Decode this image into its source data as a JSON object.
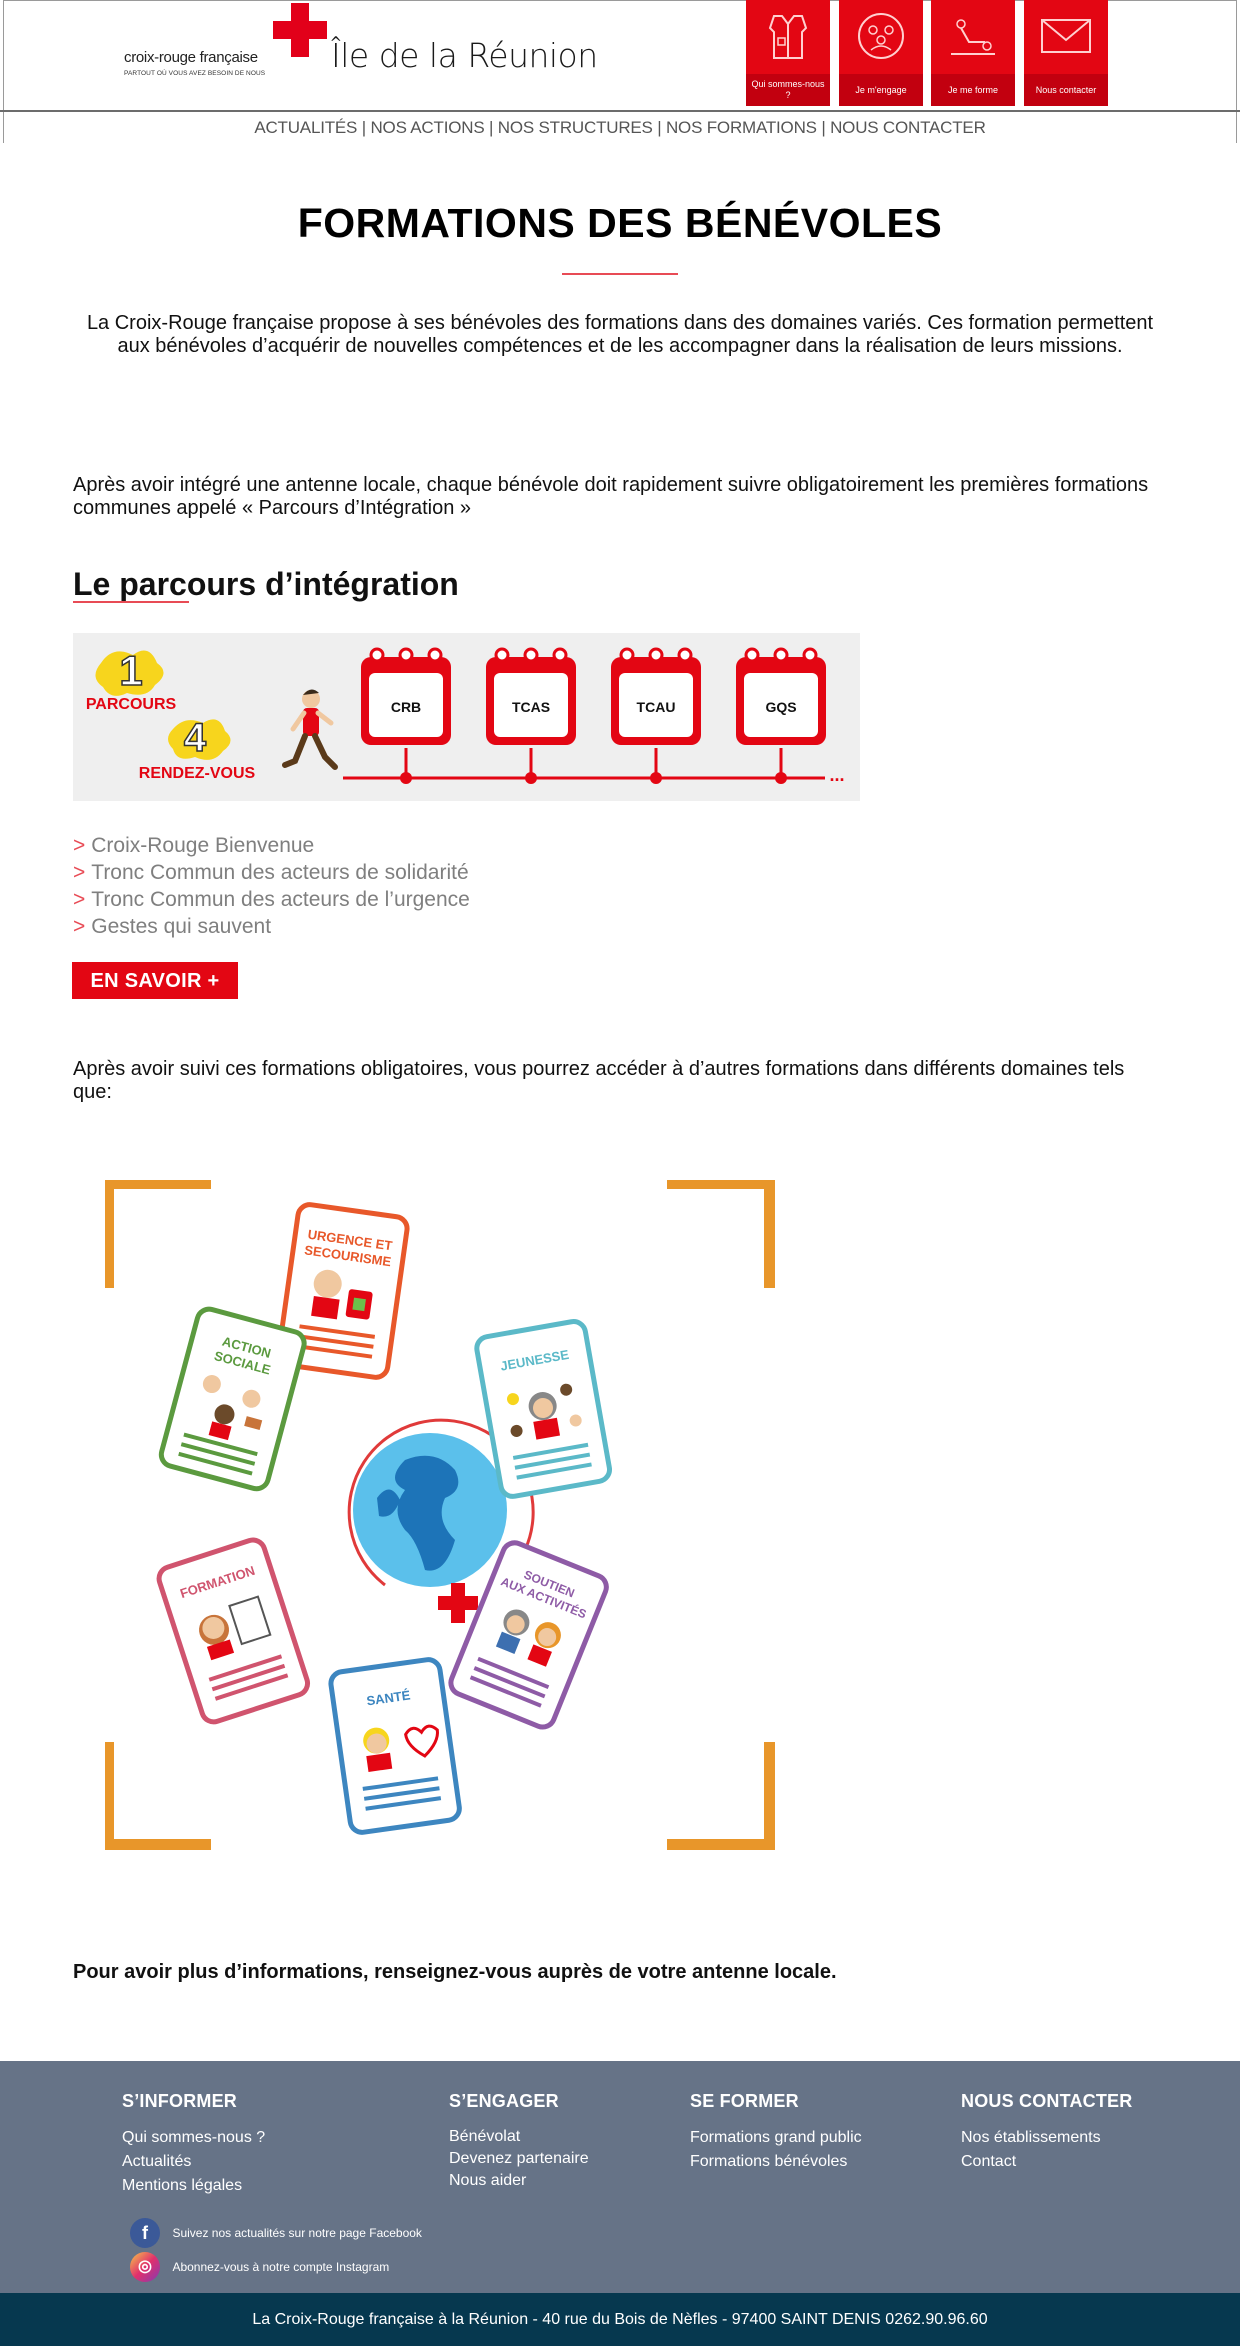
{
  "header": {
    "logo_name": "croix-rouge française",
    "logo_tagline": "PARTOUT OÙ VOUS AVEZ BESOIN DE NOUS",
    "region_title": "Île de la Réunion",
    "quick_links": [
      {
        "label": "Qui sommes-nous ?",
        "icon": "vest-icon"
      },
      {
        "label": "Je m'engage",
        "icon": "community-icon"
      },
      {
        "label": "Je me forme",
        "icon": "first-aid-icon"
      },
      {
        "label": "Nous contacter",
        "icon": "mail-icon"
      }
    ],
    "nav": [
      "ACTUALITÉS",
      "NOS ACTIONS",
      "NOS STRUCTURES",
      "NOS FORMATIONS",
      "NOUS CONTACTER"
    ],
    "brand_color": "#e30613"
  },
  "main": {
    "title": "FORMATIONS DES BÉNÉVOLES",
    "intro": "La Croix-Rouge française propose à ses bénévoles des formations dans des domaines variés. Ces formation permettent aux bénévoles d’acquérir de nouvelles compétences et de les accompagner dans la réalisation de leurs missions.",
    "para1": "Après avoir intégré une antenne locale, chaque bénévole doit rapidement suivre obligatoirement les premières formations communes  appelé « Parcours d’Intégration »",
    "section_title": "Le parcours d’intégration",
    "parcours_graphic": {
      "badge_1_number": "1",
      "badge_1_label": "PARCOURS",
      "badge_2_number": "4",
      "badge_2_label": "RENDEZ-VOUS",
      "steps": [
        "CRB",
        "TCAS",
        "TCAU",
        "GQS"
      ],
      "ellipsis": "..."
    },
    "course_arrow": ">",
    "courses": [
      "Croix-Rouge Bienvenue",
      "Tronc Commun des acteurs de solidarité",
      "Tronc Commun des acteurs de l’urgence",
      "Gestes qui sauvent"
    ],
    "cta_label": "EN SAVOIR +",
    "para2": "Après avoir suivi ces formations obligatoires, vous pourrez accéder à d’autres formations dans différents domaines tels que:",
    "domains": [
      {
        "label_lines": [
          "URGENCE ET",
          "SECOURISME"
        ],
        "color": "#e8582a"
      },
      {
        "label_lines": [
          "JEUNESSE"
        ],
        "color": "#5bb9c8"
      },
      {
        "label_lines": [
          "SOUTIEN",
          "AUX ACTIVITÉS"
        ],
        "color": "#8e5ba6"
      },
      {
        "label_lines": [
          "SANTÉ"
        ],
        "color": "#3d86c0"
      },
      {
        "label_lines": [
          "FORMATION"
        ],
        "color": "#d0546e"
      },
      {
        "label_lines": [
          "ACTION",
          "SOCIALE"
        ],
        "color": "#5b9a3f"
      }
    ],
    "closing": "Pour avoir plus d’informations, renseignez-vous auprès de votre antenne locale."
  },
  "footer": {
    "columns": [
      {
        "title": "S’INFORMER",
        "links": [
          "Qui sommes-nous ?",
          "Actualités",
          "Mentions légales"
        ]
      },
      {
        "title": "S’ENGAGER",
        "links": [
          "Bénévolat",
          "Devenez partenaire",
          "Nous aider"
        ]
      },
      {
        "title": "SE FORMER",
        "links": [
          "Formations grand public",
          "Formations bénévoles"
        ]
      },
      {
        "title": "NOUS CONTACTER",
        "links": [
          "Nos établissements",
          "Contact"
        ]
      }
    ],
    "social": [
      {
        "text": "Suivez nos actualités sur notre page Facebook",
        "icon": "facebook-icon",
        "glyph": "f"
      },
      {
        "text": "Abonnez-vous à notre compte Instagram",
        "icon": "instagram-icon",
        "glyph": "◎"
      }
    ],
    "address": "La Croix-Rouge française à la Réunion - 40 rue du Bois de Nèfles - 97400 SAINT DENIS 0262.90.96.60",
    "bg_color": "#667387",
    "bar_color": "#06384f"
  }
}
